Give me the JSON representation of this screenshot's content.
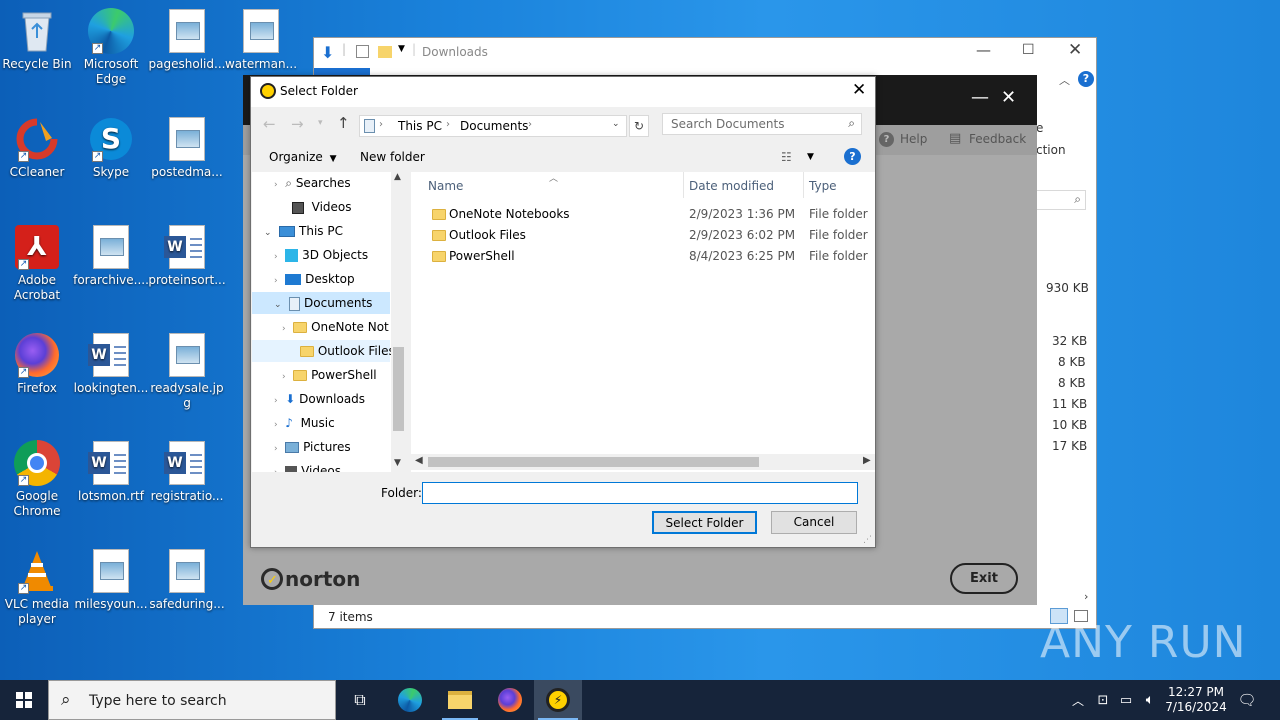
{
  "desktop": {
    "icons": [
      {
        "label": "Recycle Bin"
      },
      {
        "label": "Microsoft Edge"
      },
      {
        "label": "pagesholid..."
      },
      {
        "label": "waterman..."
      },
      {
        "label": "CCleaner"
      },
      {
        "label": "Skype"
      },
      {
        "label": "postedma..."
      },
      {
        "label": "Adobe Acrobat"
      },
      {
        "label": "forarchive...."
      },
      {
        "label": "proteinsort..."
      },
      {
        "label": "Firefox"
      },
      {
        "label": "lookingten..."
      },
      {
        "label": "readysale.jpg"
      },
      {
        "label": "Google Chrome"
      },
      {
        "label": "lotsmon.rtf"
      },
      {
        "label": "registratio..."
      },
      {
        "label": "VLC media player"
      },
      {
        "label": "milesyoun..."
      },
      {
        "label": "safeduring..."
      }
    ]
  },
  "explorer": {
    "title": "Downloads",
    "status": "7 items",
    "ribbon_partial": [
      "e",
      "ction"
    ],
    "sizes": [
      "930 KB",
      "32 KB",
      "8 KB",
      "8 KB",
      "11 KB",
      "10 KB",
      "17 KB"
    ]
  },
  "norton": {
    "help": "Help",
    "feedback": "Feedback",
    "brand": "norton",
    "exit": "Exit"
  },
  "dialog": {
    "title": "Select Folder",
    "path": [
      "This PC",
      "Documents"
    ],
    "search_placeholder": "Search Documents",
    "organize": "Organize",
    "new_folder": "New folder",
    "tree": [
      {
        "label": "Searches"
      },
      {
        "label": "Videos"
      },
      {
        "label": "This PC"
      },
      {
        "label": "3D Objects"
      },
      {
        "label": "Desktop"
      },
      {
        "label": "Documents"
      },
      {
        "label": "OneNote Not"
      },
      {
        "label": "Outlook Files"
      },
      {
        "label": "PowerShell"
      },
      {
        "label": "Downloads"
      },
      {
        "label": "Music"
      },
      {
        "label": "Pictures"
      },
      {
        "label": "Videos"
      }
    ],
    "columns": {
      "name": "Name",
      "date": "Date modified",
      "type": "Type"
    },
    "rows": [
      {
        "name": "OneNote Notebooks",
        "date": "2/9/2023 1:36 PM",
        "type": "File folder"
      },
      {
        "name": "Outlook Files",
        "date": "2/9/2023 6:02 PM",
        "type": "File folder"
      },
      {
        "name": "PowerShell",
        "date": "8/4/2023 6:25 PM",
        "type": "File folder"
      }
    ],
    "folder_label": "Folder:",
    "folder_value": "",
    "select_button": "Select Folder",
    "cancel_button": "Cancel"
  },
  "taskbar": {
    "search_placeholder": "Type here to search",
    "time": "12:27 PM",
    "date": "7/16/2024"
  },
  "watermark": "ANY RUN",
  "colors": {
    "accent": "#0078d7",
    "norton_yellow": "#ffd100",
    "desktop": "#1a82db"
  }
}
